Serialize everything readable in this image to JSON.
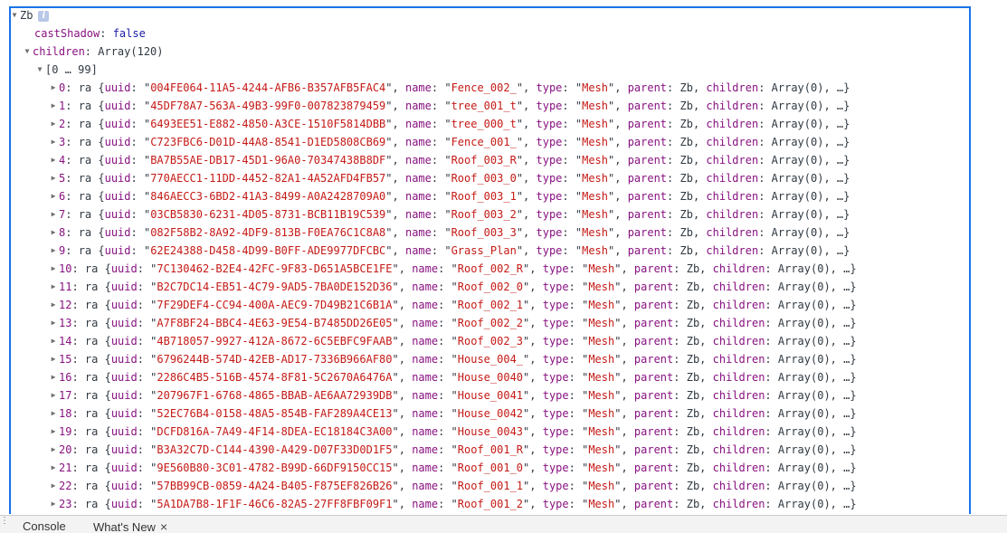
{
  "root": {
    "name": "Zb",
    "info_badge": "i",
    "cast_shadow": {
      "key": "castShadow",
      "value": "false"
    },
    "children": {
      "key": "children",
      "summary": "Array(120)"
    },
    "group_label": "[0 … 99]"
  },
  "items": [
    {
      "idx": "0",
      "uuid": "004FE064-11A5-4244-AFB6-B357AFB5FAC4",
      "name": "Fence_002_"
    },
    {
      "idx": "1",
      "uuid": "45DF78A7-563A-49B3-99F0-007823879459",
      "name": "tree_001_t"
    },
    {
      "idx": "2",
      "uuid": "6493EE51-E882-4850-A3CE-1510F5814DBB",
      "name": "tree_000_t"
    },
    {
      "idx": "3",
      "uuid": "C723FBC6-D01D-44A8-8541-D1ED5808CB69",
      "name": "Fence_001_"
    },
    {
      "idx": "4",
      "uuid": "BA7B55AE-DB17-45D1-96A0-70347438B8DF",
      "name": "Roof_003_R"
    },
    {
      "idx": "5",
      "uuid": "770AECC1-11DD-4452-82A1-4A52AFD4FB57",
      "name": "Roof_003_0"
    },
    {
      "idx": "6",
      "uuid": "846AECC3-6BD2-41A3-8499-A0A2428709A0",
      "name": "Roof_003_1"
    },
    {
      "idx": "7",
      "uuid": "03CB5830-6231-4D05-8731-BCB11B19C539",
      "name": "Roof_003_2"
    },
    {
      "idx": "8",
      "uuid": "082F58B2-8A92-4DF9-813B-F0EA76C1C8A8",
      "name": "Roof_003_3"
    },
    {
      "idx": "9",
      "uuid": "62E24388-D458-4D99-B0FF-ADE9977DFCBC",
      "name": "Grass_Plan"
    },
    {
      "idx": "10",
      "uuid": "7C130462-B2E4-42FC-9F83-D651A5BCE1FE",
      "name": "Roof_002_R"
    },
    {
      "idx": "11",
      "uuid": "B2C7DC14-EB51-4C79-9AD5-7BA0DE152D36",
      "name": "Roof_002_0"
    },
    {
      "idx": "12",
      "uuid": "7F29DEF4-CC94-400A-AEC9-7D49B21C6B1A",
      "name": "Roof_002_1"
    },
    {
      "idx": "13",
      "uuid": "A7F8BF24-BBC4-4E63-9E54-B7485DD26E05",
      "name": "Roof_002_2"
    },
    {
      "idx": "14",
      "uuid": "4B718057-9927-412A-8672-6C5EBFC9FAAB",
      "name": "Roof_002_3"
    },
    {
      "idx": "15",
      "uuid": "6796244B-574D-42EB-AD17-7336B966AF80",
      "name": "House_004_"
    },
    {
      "idx": "16",
      "uuid": "2286C4B5-516B-4574-8F81-5C2670A6476A",
      "name": "House_0040"
    },
    {
      "idx": "17",
      "uuid": "207967F1-6768-4865-BBAB-AE6AA72939DB",
      "name": "House_0041"
    },
    {
      "idx": "18",
      "uuid": "52EC76B4-0158-48A5-854B-FAF289A4CE13",
      "name": "House_0042"
    },
    {
      "idx": "19",
      "uuid": "DCFD816A-7A49-4F14-8DEA-EC18184C3A00",
      "name": "House_0043"
    },
    {
      "idx": "20",
      "uuid": "B3A32C7D-C144-4390-A429-D07F33D0D1F5",
      "name": "Roof_001_R"
    },
    {
      "idx": "21",
      "uuid": "9E560B80-3C01-4782-B99D-66DF9150CC15",
      "name": "Roof_001_0"
    },
    {
      "idx": "22",
      "uuid": "57BB99CB-0859-4A24-B405-F875EF826B26",
      "name": "Roof_001_1"
    },
    {
      "idx": "23",
      "uuid": "5A1DA7B8-1F1F-46C6-82A5-27FF8FBF09F1",
      "name": "Roof_001_2"
    }
  ],
  "item_common": {
    "class_name": "ra",
    "type": "Mesh",
    "parent": "Zb",
    "children": "Array(0)",
    "ellipsis": "…"
  },
  "drawer": {
    "tabs": [
      {
        "label": "Console"
      },
      {
        "label": "What's New",
        "close": "×"
      }
    ]
  },
  "colors": {
    "focus_border": "#1a73e8",
    "string": "#c41a16",
    "property": "#881280",
    "keyword": "#1a1aa6"
  }
}
